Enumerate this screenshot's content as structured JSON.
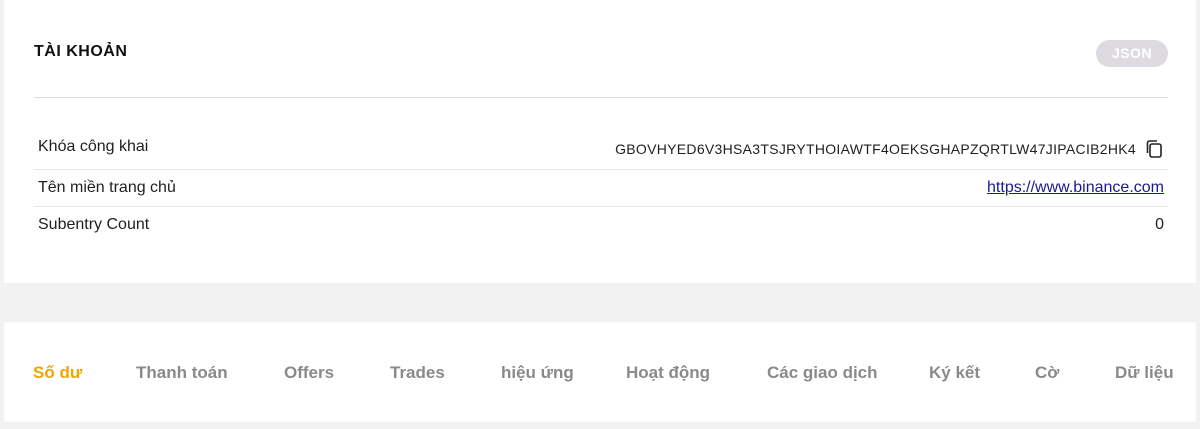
{
  "account": {
    "title": "TÀI KHOẢN",
    "json_button": "JSON",
    "rows": [
      {
        "label": "Khóa công khai",
        "value": "GBOVHYED6V3HSA3TSJRYTHOIAWTF4OEKSGHAPZQRTLW47JIPACIB2HK4",
        "icon": "copy-icon"
      },
      {
        "label": "Tên miền trang chủ",
        "value": "https://www.binance.com"
      },
      {
        "label": "Subentry Count",
        "value": "0"
      }
    ]
  },
  "tabs": [
    {
      "label": "Số dư",
      "active": true
    },
    {
      "label": "Thanh toán"
    },
    {
      "label": "Offers"
    },
    {
      "label": "Trades"
    },
    {
      "label": "hiệu ứng"
    },
    {
      "label": "Hoạt động"
    },
    {
      "label": "Các giao dịch"
    },
    {
      "label": "Ký kết"
    },
    {
      "label": "Cờ"
    },
    {
      "label": "Dữ liệu"
    }
  ],
  "colors": {
    "accent": "#f0a500",
    "tab_inactive": "#8a8a8a",
    "json_button_bg": "#dedbe0",
    "link": "#1a1a8c"
  }
}
